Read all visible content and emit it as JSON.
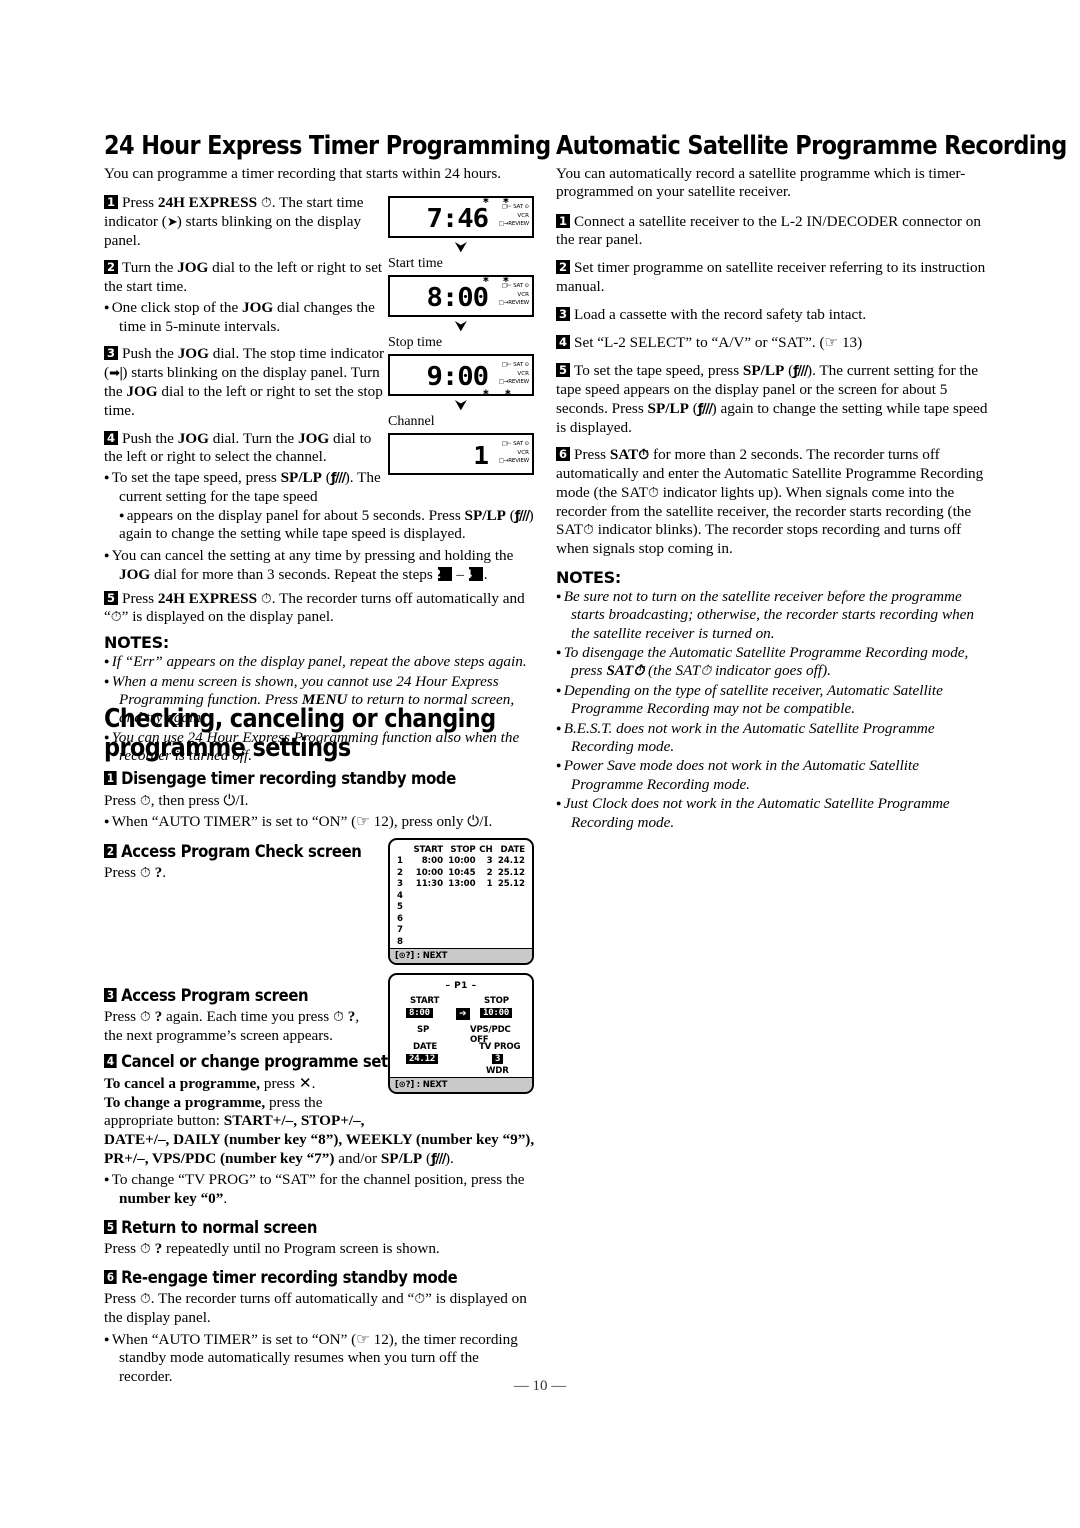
{
  "page": {
    "number_label": "— 10 —"
  },
  "left": {
    "heading1": "24 Hour Express Timer Programming",
    "lead1": "You can programme a timer recording that starts within 24 hours.",
    "steps": [
      {
        "n": "1",
        "html": "Press <b>24H EXPRESS</b> <span class=\"clk\">⊙</span>. The start time indicator (<span class=\"hand\">➤|</span>) starts blinking on the display panel."
      },
      {
        "n": "2",
        "html": "Turn the <b>JOG</b> dial to the left or right to set the start time."
      },
      {
        "n": "3",
        "html": "Push the <b>JOG</b> dial. The stop time indicator (<span class=\"hand\">→|</span>) starts blinking on the display panel. Turn the <b>JOG</b> dial to the left or right to set the stop time."
      },
      {
        "n": "4",
        "html": "Push the <b>JOG</b> dial. Turn the <b>JOG</b> dial to the left or right to select the channel."
      },
      {
        "n": "5",
        "html": "Press <b>24H EXPRESS</b> <span class=\"clk\">⊙</span>. The recorder turns off automatically and “<span class=\"clk\">⊙</span>” is displayed on the display panel."
      }
    ],
    "bullet_after_2": "One click stop of the JOG dial changes the time in 5-minute intervals.",
    "bullets_after_4": [
      "To set the tape speed, press SP/LP (ƒ///). The current setting for the tape speed appears on the display panel for about 5 seconds. Press SP/LP (ƒ///) again to change the setting while tape speed is displayed.",
      "You can cancel the setting at any time by pressing and holding the JOG dial for more than 3 seconds. Repeat the steps 2 – 4."
    ],
    "notes_heading": "NOTES:",
    "notes": [
      "If “Err” appears on the display panel, repeat the above steps again.",
      "When a menu screen is shown, you cannot use 24 Hour Express Programming function. Press MENU to return to normal screen, and try again.",
      "You can use 24 Hour Express Programming function also when the recorder is turned off."
    ],
    "heading2": "Checking, canceling or changing programme settings",
    "substeps": [
      {
        "n": "1",
        "title": "Disengage timer recording standby mode",
        "body": "Press ⊙, then press ⏻/I.",
        "bullets": [
          "When “AUTO TIMER” is set to “ON” (☞ 12), press only ⏻/I."
        ]
      },
      {
        "n": "2",
        "title": "Access Program Check screen",
        "body": "Press ⊙ ?.",
        "bullets": []
      },
      {
        "n": "3",
        "title": "Access Program screen",
        "body": "Press ⊙ ? again. Each time you press ⊙ ?, the next programme’s screen appears.",
        "bullets": []
      },
      {
        "n": "4",
        "title": "Cancel or change programme setting",
        "body": "To cancel a programme, press ✕. To change a programme, press the appropriate button: START+/–, STOP+/–, DATE+/–, DAILY (number key “8”), WEEKLY (number key “9”), PR+/–, VPS/PDC (number key “7”) and/or SP/LP (ƒ///).",
        "bullets": [
          "To change “TV PROG” to “SAT” for the channel position, press the number key “0”."
        ]
      },
      {
        "n": "5",
        "title": "Return to normal screen",
        "body": "Press ⊙ ? repeatedly until no Program screen is shown.",
        "bullets": []
      },
      {
        "n": "6",
        "title": "Re-engage timer recording standby mode",
        "body": "Press ⊙. The recorder turns off automatically and “⊙” is displayed on the display panel.",
        "bullets": [
          "When “AUTO TIMER” is set to “ON” (☞ 12), the timer recording standby mode automatically resumes when you turn off the recorder."
        ]
      }
    ]
  },
  "right": {
    "heading": "Automatic Satellite Programme Recording",
    "lead": "You can automatically record a satellite programme which is timer-programmed on your satellite receiver.",
    "steps": [
      {
        "n": "1",
        "text": "Connect a satellite receiver to the L-2 IN/DECODER connector on the rear panel."
      },
      {
        "n": "2",
        "text": "Set timer programme on satellite receiver referring to its instruction manual."
      },
      {
        "n": "3",
        "text": "Load a cassette with the record safety tab intact."
      },
      {
        "n": "4",
        "text": "Set “L-2 SELECT” to “A/V” or “SAT”. (☞ 13)"
      },
      {
        "n": "5",
        "text": "To set the tape speed, press SP/LP (ƒ///). The current setting for the tape speed appears on the display panel or the screen for about 5 seconds. Press SP/LP (ƒ///) again to change the setting while tape speed is displayed."
      },
      {
        "n": "6",
        "text": "Press SAT⊙ for more than 2 seconds. The recorder turns off automatically and enter the Automatic Satellite Programme Recording mode (the SAT⊙ indicator lights up). When signals come into the recorder from the satellite receiver, the recorder starts recording (the SAT⊙ indicator blinks). The recorder stops recording and turns off when signals stop coming in."
      }
    ],
    "notes_heading": "NOTES:",
    "notes": [
      "Be sure not to turn on the satellite receiver before the programme starts broadcasting; otherwise, the recorder starts recording when the satellite receiver is turned on.",
      "To disengage the Automatic Satellite Programme Recording mode, press SAT⊙ (the SAT⊙ indicator goes off).",
      "Depending on the type of satellite receiver, Automatic Satellite Programme Recording may not be compatible.",
      "B.E.S.T. does not work in the Automatic Satellite Programme Recording mode.",
      "Power Save mode does not work in the Automatic Satellite Programme Recording mode.",
      "Just Clock does not work in the Automatic Satellite Programme Recording mode."
    ]
  },
  "lcd_panels": [
    {
      "value": "7:46",
      "label": "Start time",
      "blink_top": true,
      "blink_bottom": false,
      "ind1": "□⊢ SAT ⊙",
      "ind2": "VCR",
      "ind3": "□→REVIEW"
    },
    {
      "value": "8:00",
      "label": "Stop time",
      "blink_top": true,
      "blink_bottom": false,
      "ind1": "□⊢ SAT ⊙",
      "ind2": "VCR",
      "ind3": "□→REVIEW"
    },
    {
      "value": "9:00",
      "label": "Channel",
      "blink_top": false,
      "blink_bottom": true,
      "ind1": "□⊢ SAT ⊙",
      "ind2": "VCR",
      "ind3": "□→REVIEW"
    },
    {
      "value": "1",
      "label": "",
      "blink_top": false,
      "blink_bottom": false,
      "ind1": "□⊢ SAT ⊙",
      "ind2": "VCR",
      "ind3": "□→REVIEW"
    }
  ],
  "program_check": {
    "headers": [
      "",
      "START",
      "STOP",
      "CH",
      "DATE"
    ],
    "rows": [
      [
        "1",
        "8:00",
        "10:00",
        "3",
        "24.12"
      ],
      [
        "2",
        "10:00",
        "10:45",
        "2",
        "25.12"
      ],
      [
        "3",
        "11:30",
        "13:00",
        "1",
        "25.12"
      ],
      [
        "4",
        "",
        "",
        "",
        ""
      ],
      [
        "5",
        "",
        "",
        "",
        ""
      ],
      [
        "6",
        "",
        "",
        "",
        ""
      ],
      [
        "7",
        "",
        "",
        "",
        ""
      ],
      [
        "8",
        "",
        "",
        "",
        ""
      ]
    ],
    "footer": "[⊙?] : NEXT"
  },
  "program_screen": {
    "title": "– P1 –",
    "start_label": "START",
    "start_value": "8:00",
    "arrow": "➔",
    "stop_label": "STOP",
    "stop_value": "10:00",
    "speed": "SP",
    "vps": "VPS/PDC OFF",
    "date_label": "DATE",
    "date_value": "24.12",
    "prog_label": "TV PROG",
    "prog_value": "3",
    "station": "WDR",
    "footer": "[⊙?] : NEXT"
  }
}
